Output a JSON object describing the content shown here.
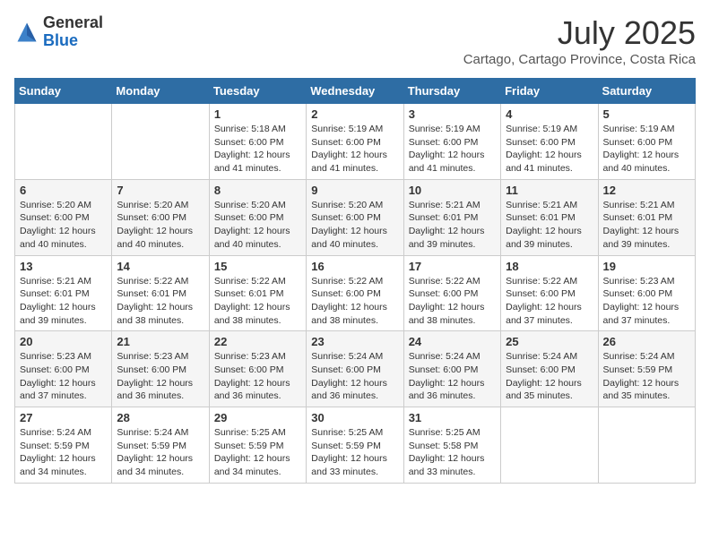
{
  "header": {
    "logo_general": "General",
    "logo_blue": "Blue",
    "month_title": "July 2025",
    "subtitle": "Cartago, Cartago Province, Costa Rica"
  },
  "weekdays": [
    "Sunday",
    "Monday",
    "Tuesday",
    "Wednesday",
    "Thursday",
    "Friday",
    "Saturday"
  ],
  "weeks": [
    [
      {
        "day": "",
        "info": ""
      },
      {
        "day": "",
        "info": ""
      },
      {
        "day": "1",
        "info": "Sunrise: 5:18 AM\nSunset: 6:00 PM\nDaylight: 12 hours and 41 minutes."
      },
      {
        "day": "2",
        "info": "Sunrise: 5:19 AM\nSunset: 6:00 PM\nDaylight: 12 hours and 41 minutes."
      },
      {
        "day": "3",
        "info": "Sunrise: 5:19 AM\nSunset: 6:00 PM\nDaylight: 12 hours and 41 minutes."
      },
      {
        "day": "4",
        "info": "Sunrise: 5:19 AM\nSunset: 6:00 PM\nDaylight: 12 hours and 41 minutes."
      },
      {
        "day": "5",
        "info": "Sunrise: 5:19 AM\nSunset: 6:00 PM\nDaylight: 12 hours and 40 minutes."
      }
    ],
    [
      {
        "day": "6",
        "info": "Sunrise: 5:20 AM\nSunset: 6:00 PM\nDaylight: 12 hours and 40 minutes."
      },
      {
        "day": "7",
        "info": "Sunrise: 5:20 AM\nSunset: 6:00 PM\nDaylight: 12 hours and 40 minutes."
      },
      {
        "day": "8",
        "info": "Sunrise: 5:20 AM\nSunset: 6:00 PM\nDaylight: 12 hours and 40 minutes."
      },
      {
        "day": "9",
        "info": "Sunrise: 5:20 AM\nSunset: 6:00 PM\nDaylight: 12 hours and 40 minutes."
      },
      {
        "day": "10",
        "info": "Sunrise: 5:21 AM\nSunset: 6:01 PM\nDaylight: 12 hours and 39 minutes."
      },
      {
        "day": "11",
        "info": "Sunrise: 5:21 AM\nSunset: 6:01 PM\nDaylight: 12 hours and 39 minutes."
      },
      {
        "day": "12",
        "info": "Sunrise: 5:21 AM\nSunset: 6:01 PM\nDaylight: 12 hours and 39 minutes."
      }
    ],
    [
      {
        "day": "13",
        "info": "Sunrise: 5:21 AM\nSunset: 6:01 PM\nDaylight: 12 hours and 39 minutes."
      },
      {
        "day": "14",
        "info": "Sunrise: 5:22 AM\nSunset: 6:01 PM\nDaylight: 12 hours and 38 minutes."
      },
      {
        "day": "15",
        "info": "Sunrise: 5:22 AM\nSunset: 6:01 PM\nDaylight: 12 hours and 38 minutes."
      },
      {
        "day": "16",
        "info": "Sunrise: 5:22 AM\nSunset: 6:00 PM\nDaylight: 12 hours and 38 minutes."
      },
      {
        "day": "17",
        "info": "Sunrise: 5:22 AM\nSunset: 6:00 PM\nDaylight: 12 hours and 38 minutes."
      },
      {
        "day": "18",
        "info": "Sunrise: 5:22 AM\nSunset: 6:00 PM\nDaylight: 12 hours and 37 minutes."
      },
      {
        "day": "19",
        "info": "Sunrise: 5:23 AM\nSunset: 6:00 PM\nDaylight: 12 hours and 37 minutes."
      }
    ],
    [
      {
        "day": "20",
        "info": "Sunrise: 5:23 AM\nSunset: 6:00 PM\nDaylight: 12 hours and 37 minutes."
      },
      {
        "day": "21",
        "info": "Sunrise: 5:23 AM\nSunset: 6:00 PM\nDaylight: 12 hours and 36 minutes."
      },
      {
        "day": "22",
        "info": "Sunrise: 5:23 AM\nSunset: 6:00 PM\nDaylight: 12 hours and 36 minutes."
      },
      {
        "day": "23",
        "info": "Sunrise: 5:24 AM\nSunset: 6:00 PM\nDaylight: 12 hours and 36 minutes."
      },
      {
        "day": "24",
        "info": "Sunrise: 5:24 AM\nSunset: 6:00 PM\nDaylight: 12 hours and 36 minutes."
      },
      {
        "day": "25",
        "info": "Sunrise: 5:24 AM\nSunset: 6:00 PM\nDaylight: 12 hours and 35 minutes."
      },
      {
        "day": "26",
        "info": "Sunrise: 5:24 AM\nSunset: 5:59 PM\nDaylight: 12 hours and 35 minutes."
      }
    ],
    [
      {
        "day": "27",
        "info": "Sunrise: 5:24 AM\nSunset: 5:59 PM\nDaylight: 12 hours and 34 minutes."
      },
      {
        "day": "28",
        "info": "Sunrise: 5:24 AM\nSunset: 5:59 PM\nDaylight: 12 hours and 34 minutes."
      },
      {
        "day": "29",
        "info": "Sunrise: 5:25 AM\nSunset: 5:59 PM\nDaylight: 12 hours and 34 minutes."
      },
      {
        "day": "30",
        "info": "Sunrise: 5:25 AM\nSunset: 5:59 PM\nDaylight: 12 hours and 33 minutes."
      },
      {
        "day": "31",
        "info": "Sunrise: 5:25 AM\nSunset: 5:58 PM\nDaylight: 12 hours and 33 minutes."
      },
      {
        "day": "",
        "info": ""
      },
      {
        "day": "",
        "info": ""
      }
    ]
  ]
}
